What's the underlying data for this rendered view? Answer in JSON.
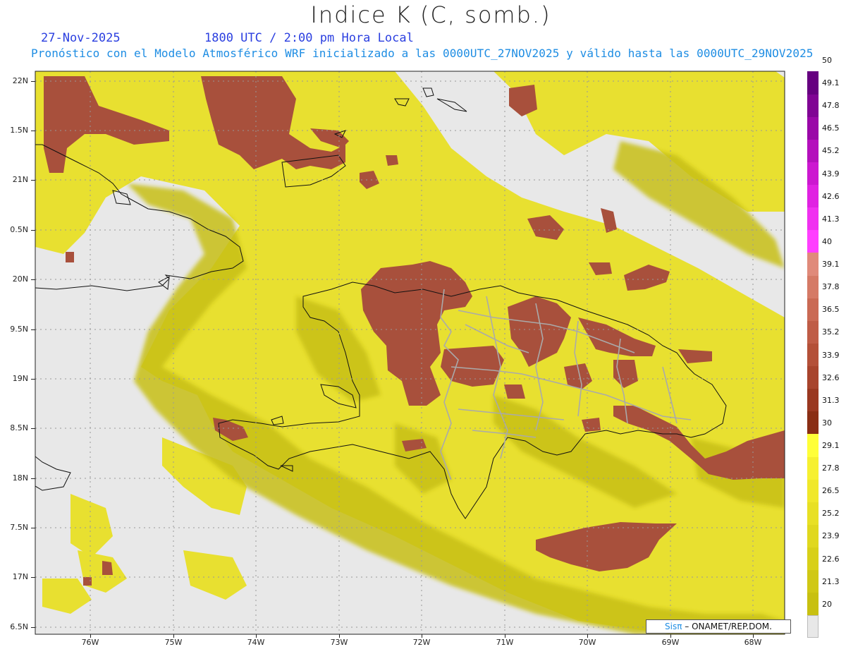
{
  "header": {
    "title": "Indice K (C, somb.)",
    "date": "27-Nov-2025",
    "time": "1800 UTC / 2:00 pm Hora Local",
    "subtitle": "Pronóstico con el Modelo Atmosférico WRF inicializado a las 0000UTC_27NOV2025 y válido hasta las  0000UTC_29NOV2025"
  },
  "axes": {
    "lat_labels": [
      "22N",
      "1.5N",
      "21N",
      "0.5N",
      "20N",
      "9.5N",
      "19N",
      "8.5N",
      "18N",
      "7.5N",
      "17N",
      "6.5N"
    ],
    "lon_labels": [
      "76W",
      "75W",
      "74W",
      "73W",
      "72W",
      "71W",
      "70W",
      "69W",
      "68W"
    ]
  },
  "colorbar": {
    "levels": [
      "20",
      "21.3",
      "22.6",
      "23.9",
      "25.2",
      "26.5",
      "27.8",
      "29.1",
      "30",
      "31.3",
      "32.6",
      "33.9",
      "35.2",
      "36.5",
      "37.8",
      "39.1",
      "40",
      "41.3",
      "42.6",
      "43.9",
      "45.2",
      "46.5",
      "47.8",
      "49.1",
      "50"
    ],
    "colors": [
      "#c8c010",
      "#d0c814",
      "#d8d018",
      "#e0d81e",
      "#e8e024",
      "#f0e82a",
      "#f6f030",
      "#ffff38",
      "#8a2e14",
      "#9a3820",
      "#a8442c",
      "#b45038",
      "#bf5c46",
      "#ca6a54",
      "#d57a66",
      "#e08a7a",
      "#ff3fff",
      "#f030f0",
      "#e022e2",
      "#cc18d0",
      "#b410bc",
      "#9a08a8",
      "#800494",
      "#660080"
    ]
  },
  "map": {
    "background": "#e8e8e8",
    "yellow": "#e8e030",
    "olive": "#c8c018",
    "red": "#a8503c",
    "coast": "#111111",
    "border": "#aaaaaa"
  },
  "credit": {
    "prefix": "Sisπ",
    "text": " – ONAMET/REP.DOM."
  }
}
